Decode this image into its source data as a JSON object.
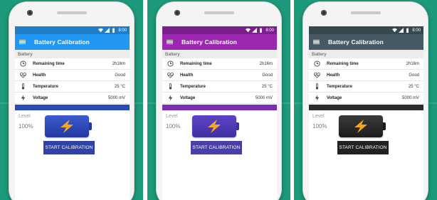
{
  "panels": [
    {
      "theme": {
        "background": "#1d9a7a",
        "appbar": "#2196f3",
        "statusbar": "#1f7dc6",
        "accent": "#2a4bb5",
        "button": "#3042a5",
        "battery_top": "#3a5ccd",
        "battery_bottom": "#2337a0"
      },
      "status_time": "8:00",
      "app_title": "Battery Calibration",
      "section_header": "Battery",
      "rows": [
        {
          "icon": "clock-icon",
          "label": "Remaining time",
          "value": "2h16m"
        },
        {
          "icon": "heart-pulse-icon",
          "label": "Health",
          "value": "Good"
        },
        {
          "icon": "thermometer-icon",
          "label": "Temperature",
          "value": "25 °C"
        },
        {
          "icon": "bolt-icon",
          "label": "Voltage",
          "value": "5000 mV"
        }
      ],
      "level_label": "Level",
      "level_value": "100%",
      "button_label": "START CALIBRATION"
    },
    {
      "theme": {
        "background": "#1d9a7a",
        "appbar": "#9c27b0",
        "statusbar": "#7b1f8e",
        "accent": "#7b2fb0",
        "button": "#4a3fa8",
        "battery_top": "#5f43c9",
        "battery_bottom": "#4030a0"
      },
      "status_time": "8:00",
      "app_title": "Battery Calibration",
      "section_header": "Battery",
      "rows": [
        {
          "icon": "clock-icon",
          "label": "Remaining time",
          "value": "2h16m"
        },
        {
          "icon": "heart-pulse-icon",
          "label": "Health",
          "value": "Good"
        },
        {
          "icon": "thermometer-icon",
          "label": "Temperature",
          "value": "25 °C"
        },
        {
          "icon": "bolt-icon",
          "label": "Voltage",
          "value": "5000 mV"
        }
      ],
      "level_label": "Level",
      "level_value": "100%",
      "button_label": "START CALIBRATION"
    },
    {
      "theme": {
        "background": "#1d9a7a",
        "appbar": "#455a64",
        "statusbar": "#37474f",
        "accent": "#2b2b2b",
        "button": "#222222",
        "battery_top": "#3a3a3a",
        "battery_bottom": "#1c1c1c"
      },
      "status_time": "8:00",
      "app_title": "Battery Calibration",
      "section_header": "Battery",
      "rows": [
        {
          "icon": "clock-icon",
          "label": "Remaining time",
          "value": "2h16m"
        },
        {
          "icon": "heart-pulse-icon",
          "label": "Health",
          "value": "Good"
        },
        {
          "icon": "thermometer-icon",
          "label": "Temperature",
          "value": "25 °C"
        },
        {
          "icon": "bolt-icon",
          "label": "Voltage",
          "value": "5000 mV"
        }
      ],
      "level_label": "Level",
      "level_value": "100%",
      "button_label": "START CALIBRATION"
    }
  ]
}
